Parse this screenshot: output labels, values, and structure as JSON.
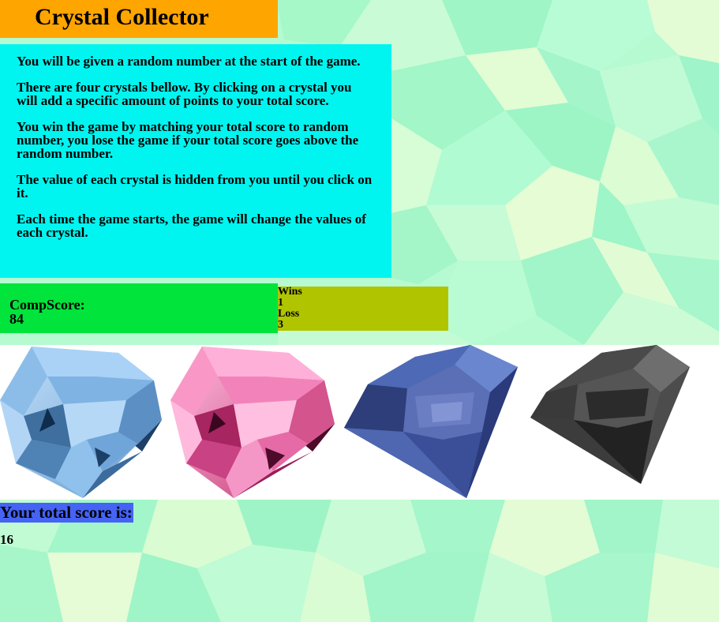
{
  "header": {
    "title": "Crystal Collector"
  },
  "instructions": [
    "You will be given a random number at the start of the game.",
    "There are four crystals bellow. By clicking on a crystal you will add a specific amount of points to your total score.",
    "You win the game by matching your total score to random number, you lose the game if your total score goes above the random number.",
    "The value of each crystal is hidden from you until you click on it.",
    "Each time the game starts, the game will change the values of each crystal."
  ],
  "comp_score": {
    "label": "CompScore:",
    "value": "84"
  },
  "record": {
    "wins_label": "Wins",
    "wins": "1",
    "loss_label": "Loss",
    "loss": "3"
  },
  "crystals": [
    {
      "name": "light-blue-crystal",
      "color": "#8fc4ef"
    },
    {
      "name": "pink-crystal",
      "color": "#f07ab9"
    },
    {
      "name": "dark-blue-crystal",
      "color": "#3a4f9a"
    },
    {
      "name": "black-crystal",
      "color": "#3a3a3a"
    }
  ],
  "total": {
    "label": "Your total score is:",
    "value": "16"
  },
  "colors": {
    "title_bg": "#ffa500",
    "instructions_bg": "#00f5f0",
    "comp_score_bg": "#00e43c",
    "record_bg": "#b0c400",
    "total_label_bg": "#4563f5",
    "page_bg": "#b6fbd3"
  }
}
